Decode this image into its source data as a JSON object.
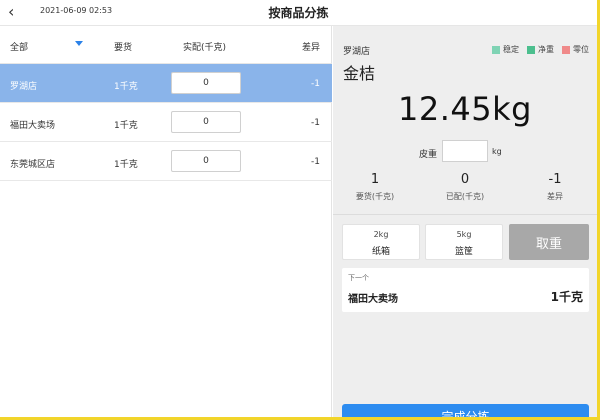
{
  "header": {
    "datetime": "2021-06-09 02:53",
    "title": "按商品分拣"
  },
  "table": {
    "headers": {
      "store": "全部",
      "need": "要货",
      "actual": "实配(千克)",
      "diff": "差异"
    },
    "rows": [
      {
        "store": "罗湖店",
        "need": "1千克",
        "actual": "0",
        "diff": "-1",
        "selected": true
      },
      {
        "store": "福田大卖场",
        "need": "1千克",
        "actual": "0",
        "diff": "-1",
        "selected": false
      },
      {
        "store": "东莞城区店",
        "need": "1千克",
        "actual": "0",
        "diff": "-1",
        "selected": false
      }
    ]
  },
  "detail": {
    "store": "罗湖店",
    "product": "金桔",
    "legend": [
      {
        "label": "稳定",
        "color": "#7fd3b4"
      },
      {
        "label": "净重",
        "color": "#4cbf8e"
      },
      {
        "label": "零位",
        "color": "#f08a8a"
      }
    ],
    "weight": "12.45kg",
    "tare_label": "皮重",
    "tare_value": "",
    "tare_unit": "kg",
    "stats": [
      {
        "value": "1",
        "label": "要货(千克)"
      },
      {
        "value": "0",
        "label": "已配(千克)"
      },
      {
        "value": "-1",
        "label": "差异"
      }
    ],
    "tare_buttons": [
      {
        "weight": "2kg",
        "name": "纸箱"
      },
      {
        "weight": "5kg",
        "name": "篮筐"
      }
    ],
    "clear_label": "取重",
    "next": {
      "label": "下一个",
      "store": "福田大卖场",
      "qty": "1千克"
    },
    "complete_label": "完成分拣"
  },
  "colors": {
    "selected_row": "#8ab4ea",
    "primary": "#2d8cf0",
    "accent_border": "#f2d52a"
  }
}
